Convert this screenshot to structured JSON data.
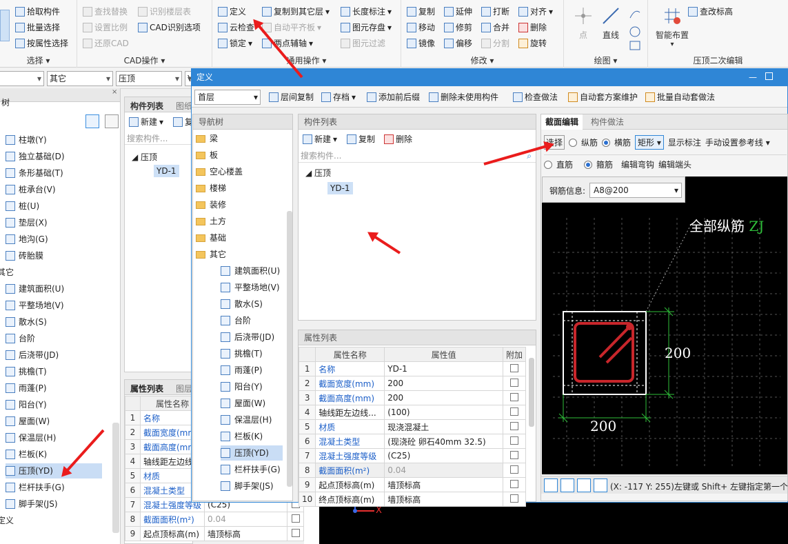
{
  "ribbon": {
    "g1": {
      "title": "选择",
      "items": [
        "拾取构件",
        "批量选择",
        "按属性选择"
      ]
    },
    "g2": {
      "title": "CAD操作",
      "items": [
        "查找替换",
        "识别楼层表",
        "设置比例",
        "CAD识别选项",
        "还原CAD"
      ]
    },
    "g3": {
      "title": "通用操作",
      "items": [
        "定义",
        "复制到其它层",
        "长度标注",
        "云检查",
        "自动平齐板",
        "图元存盘",
        "锁定",
        "两点辅轴",
        "图元过滤"
      ]
    },
    "g4": {
      "title": "修改",
      "items": [
        "复制",
        "延伸",
        "打断",
        "对齐",
        "移动",
        "修剪",
        "合并",
        "删除",
        "镜像",
        "偏移",
        "分割",
        "旋转"
      ]
    },
    "g5": {
      "title": "绘图",
      "items": [
        "点",
        "直线"
      ]
    },
    "g6": {
      "title": "压顶二次编辑",
      "items": [
        "智能布置",
        "查改标高"
      ]
    }
  },
  "combos": [
    "其它",
    "压顶",
    "Y"
  ],
  "left_tree": {
    "header": "树",
    "items": [
      "柱墩(Y)",
      "独立基础(D)",
      "条形基础(T)",
      "桩承台(V)",
      "桩(U)",
      "垫层(X)",
      "地沟(G)",
      "砖胎膜",
      "其它",
      "建筑面积(U)",
      "平整场地(V)",
      "散水(S)",
      "台阶",
      "后浇带(JD)",
      "挑檐(T)",
      "雨蓬(P)",
      "阳台(Y)",
      "屋面(W)",
      "保温层(H)",
      "栏板(K)",
      "压顶(YD)",
      "栏杆扶手(G)",
      "脚手架(JS)",
      "定义"
    ]
  },
  "mid_panel": {
    "tabs": [
      "构件列表",
      "图纸"
    ],
    "new": "新建",
    "copy": "复",
    "search": "搜索构件...",
    "tree_root": "压顶",
    "tree_child": "YD-1",
    "prop_tabs": [
      "属性列表",
      "图层"
    ],
    "prop_head": "属性名称",
    "props": [
      [
        "1",
        "名称",
        ""
      ],
      [
        "2",
        "截面宽度(mm",
        ""
      ],
      [
        "3",
        "截面高度(mm",
        ""
      ],
      [
        "4",
        "轴线距左边线",
        ""
      ],
      [
        "5",
        "材质",
        ""
      ],
      [
        "6",
        "混凝土类型",
        ""
      ],
      [
        "7",
        "混凝土强度等级",
        "(C25)"
      ],
      [
        "8",
        "截面面积(m²)",
        "0.04"
      ],
      [
        "9",
        "起点顶标高(m)",
        "墙顶标高"
      ]
    ]
  },
  "dialog": {
    "title": "定义",
    "floor": "首层",
    "toolbar": [
      "层间复制",
      "存档",
      "添加前后缀",
      "删除未使用构件",
      "检查做法",
      "自动套方案维护",
      "批量自动套做法"
    ],
    "nav_title": "导航树",
    "nav": [
      "梁",
      "板",
      "空心楼盖",
      "楼梯",
      "装修",
      "土方",
      "基础",
      "其它"
    ],
    "nav_sub": [
      "建筑面积(U)",
      "平整场地(V)",
      "散水(S)",
      "台阶",
      "后浇带(JD)",
      "挑檐(T)",
      "雨蓬(P)",
      "阳台(Y)",
      "屋面(W)",
      "保温层(H)",
      "栏板(K)",
      "压顶(YD)",
      "栏杆扶手(G)",
      "脚手架(JS)"
    ],
    "comp_title": "构件列表",
    "comp_new": "新建",
    "comp_copy": "复制",
    "comp_delete": "删除",
    "comp_search": "搜索构件...",
    "comp_root": "压顶",
    "comp_child": "YD-1",
    "prop_title": "属性列表",
    "prop_cols": [
      "属性名称",
      "属性值",
      "附加"
    ],
    "props": [
      [
        "1",
        "名称",
        "YD-1"
      ],
      [
        "2",
        "截面宽度(mm)",
        "200"
      ],
      [
        "3",
        "截面高度(mm)",
        "200"
      ],
      [
        "4",
        "轴线距左边线...",
        "(100)"
      ],
      [
        "5",
        "材质",
        "现浇混凝土"
      ],
      [
        "6",
        "混凝土类型",
        "(现浇砼 卵石40mm 32.5)"
      ],
      [
        "7",
        "混凝土强度等级",
        "(C25)"
      ],
      [
        "8",
        "截面面积(m²)",
        "0.04"
      ],
      [
        "9",
        "起点顶标高(m)",
        "墙顶标高"
      ],
      [
        "10",
        "终点顶标高(m)",
        "墙顶标高"
      ]
    ],
    "right_tabs": [
      "截面编辑",
      "构件做法"
    ],
    "right_row1": [
      "选择",
      "纵筋",
      "横筋",
      "矩形",
      "显示标注",
      "手动设置参考线"
    ],
    "right_row2": [
      "直筋",
      "箍筋",
      "编辑弯钩",
      "编辑端头"
    ],
    "rebar_label": "钢筋信息:",
    "rebar_value": "A8@200",
    "canvas_note": "全部纵筋",
    "canvas_note_tag": "ZJ",
    "dim_w": "200",
    "dim_h": "200",
    "status": "(X: -117 Y: 255)左键或 Shift+ 左键指定第一个角"
  },
  "axis_x": "X",
  "colors": {
    "accent": "#2f86d6",
    "arrow": "#ea1c1c",
    "rebar": "#c8262b",
    "dim": "#2fbf3a"
  }
}
